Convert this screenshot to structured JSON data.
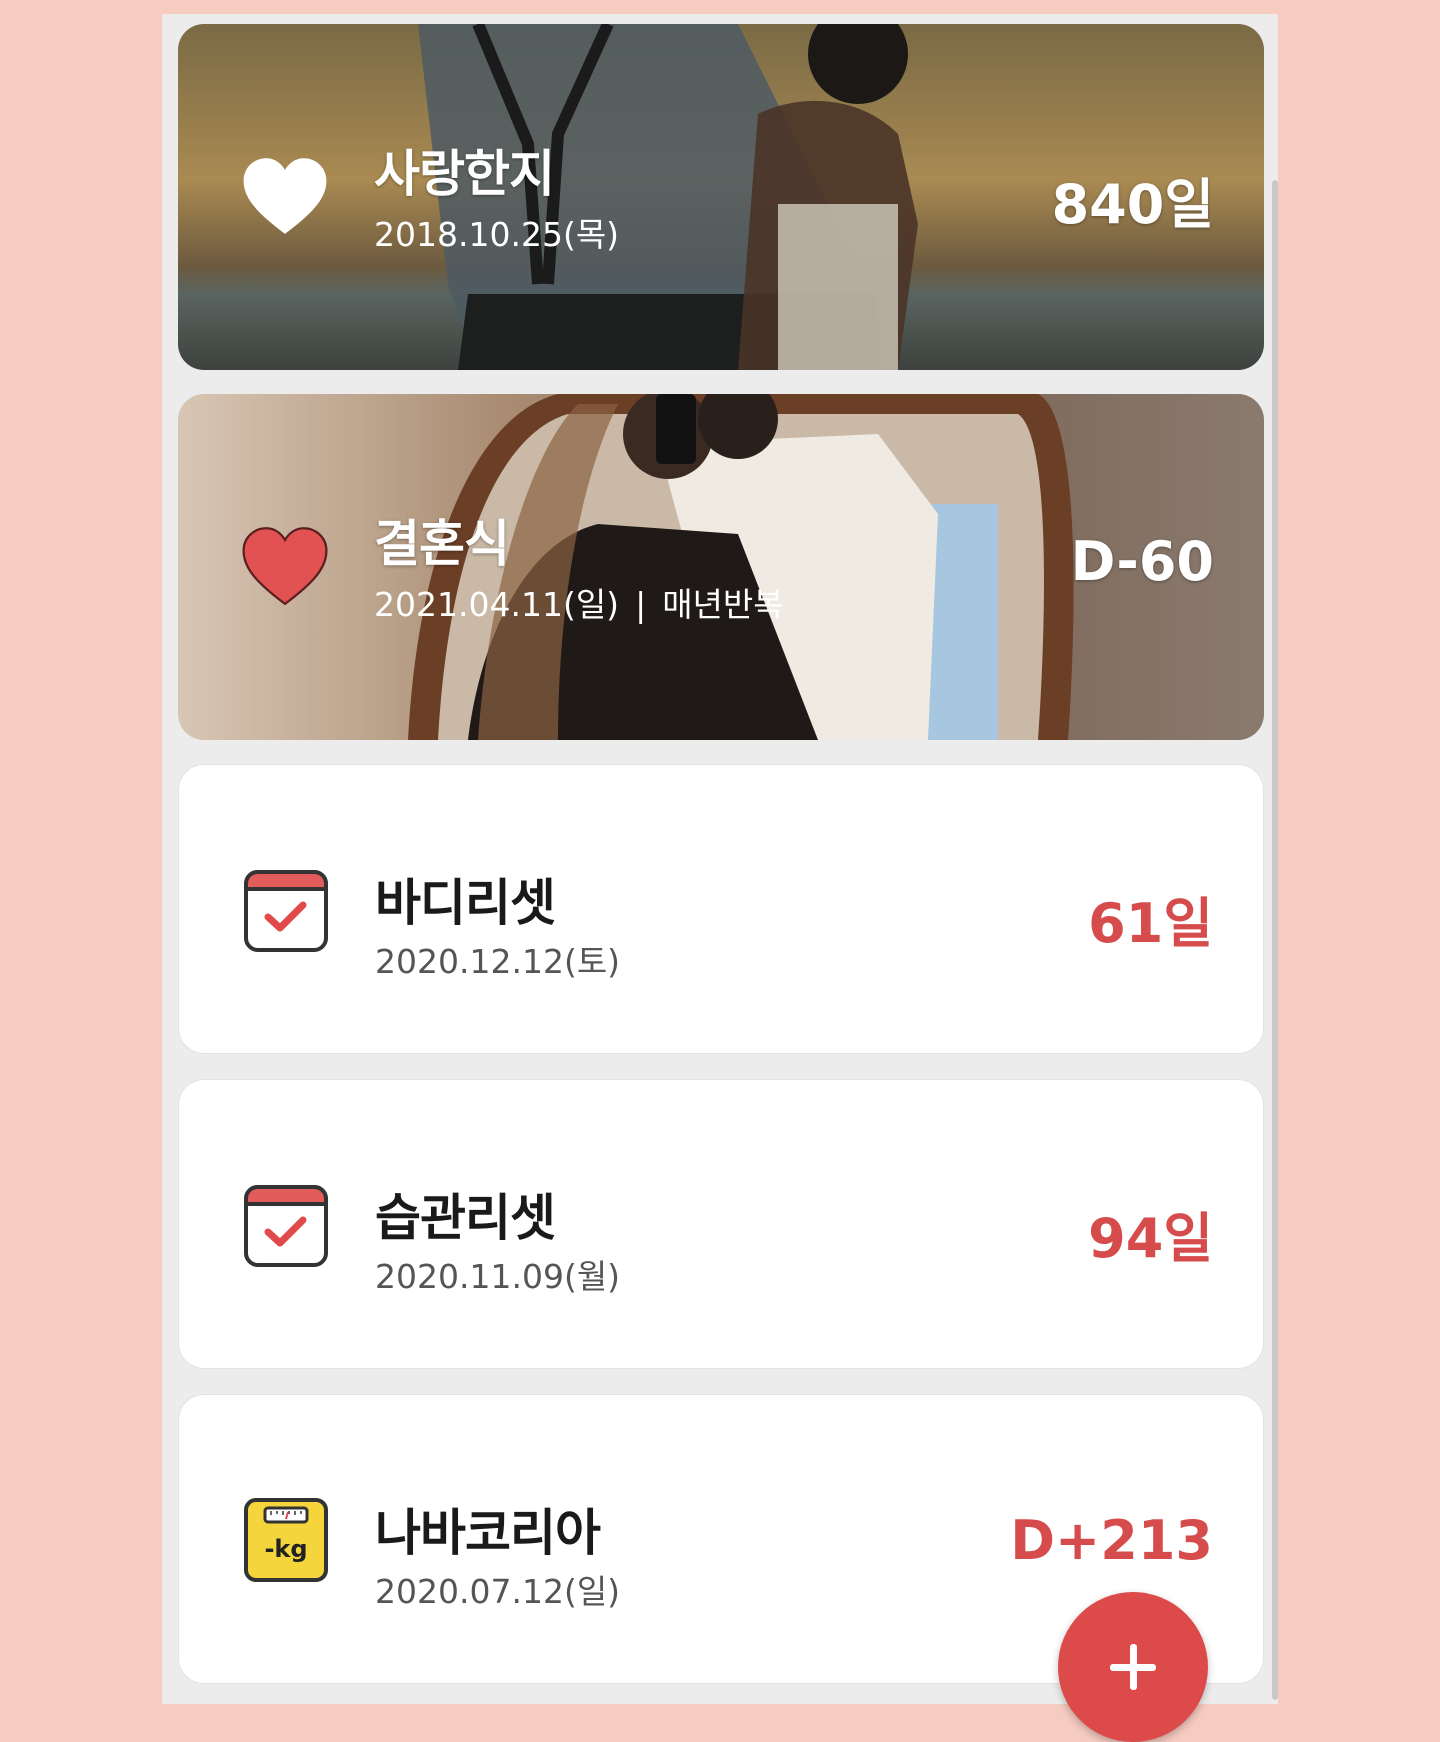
{
  "colors": {
    "page_background": "#f6cbc0",
    "app_background": "#ececec",
    "accent_red": "#d64b4b",
    "fab_red": "#dc4a4a"
  },
  "cards": [
    {
      "title": "사랑한지",
      "date": "2018.10.25(목)",
      "count": "840일",
      "icon": "heart-white-icon",
      "style": "photo"
    },
    {
      "title": "결혼식",
      "date": "2021.04.11(일)",
      "separator": "|",
      "repeat": "매년반복",
      "count": "D-60",
      "icon": "heart-red-icon",
      "style": "photo"
    },
    {
      "title": "바디리셋",
      "date": "2020.12.12(토)",
      "count": "61일",
      "icon": "calendar-check-icon",
      "style": "plain"
    },
    {
      "title": "습관리셋",
      "date": "2020.11.09(월)",
      "count": "94일",
      "icon": "calendar-check-icon",
      "style": "plain"
    },
    {
      "title": "나바코리아",
      "date": "2020.07.12(일)",
      "count": "D+213",
      "icon": "scale-kg-icon",
      "icon_text": "-kg",
      "style": "plain"
    }
  ],
  "fab": {
    "icon": "plus-icon"
  }
}
